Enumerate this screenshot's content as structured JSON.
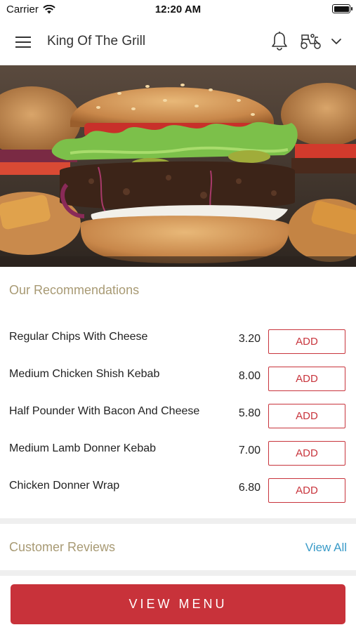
{
  "status_bar": {
    "carrier": "Carrier",
    "time": "12:20 AM"
  },
  "header": {
    "title": "King Of The Grill"
  },
  "recommendations": {
    "title": "Our Recommendations",
    "items": [
      {
        "name": "Regular Chips With Cheese",
        "price": "3.20",
        "button": "ADD"
      },
      {
        "name": "Medium Chicken Shish Kebab",
        "price": "8.00",
        "button": "ADD"
      },
      {
        "name": "Half Pounder With Bacon And Cheese",
        "price": "5.80",
        "button": "ADD"
      },
      {
        "name": "Medium Lamb Donner Kebab",
        "price": "7.00",
        "button": "ADD"
      },
      {
        "name": "Chicken Donner Wrap",
        "price": "6.80",
        "button": "ADD"
      }
    ]
  },
  "reviews": {
    "title": "Customer Reviews",
    "view_all": "View All"
  },
  "footer": {
    "view_menu": "VIEW MENU"
  },
  "colors": {
    "accent": "#c8323a",
    "section_title": "#a89a74",
    "link": "#3a9bc8"
  }
}
